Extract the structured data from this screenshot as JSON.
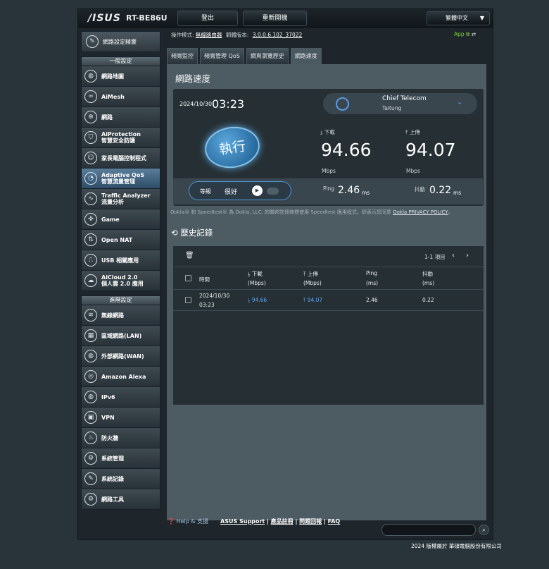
{
  "header": {
    "brand": "/ISUS",
    "model": "RT-BE86U",
    "logout": "登出",
    "reboot": "重新開機",
    "language": "繁體中文"
  },
  "status": {
    "opmode_label": "操作模式:",
    "opmode_value": "無線路由器",
    "fw_label": "韌體版本:",
    "fw_value": "3.0.0.6.102_37022",
    "app_label": "App"
  },
  "sidebar": {
    "setup_wizard": "網路設定精靈",
    "general_title": "一般設定",
    "general": [
      {
        "label": "網路地圖",
        "icon": "globe-icon"
      },
      {
        "label": "AiMesh",
        "icon": "aimesh-icon"
      },
      {
        "label": "網路",
        "icon": "network-icon"
      },
      {
        "label": "AiProtection",
        "label2": "智慧安全防護",
        "icon": "shield-icon"
      },
      {
        "label": "家長電腦控制程式",
        "icon": "family-icon"
      },
      {
        "label": "Adaptive QoS",
        "label2": "智慧流量管理",
        "icon": "speedometer-icon"
      },
      {
        "label": "Traffic Analyzer",
        "label2": "流量分析",
        "icon": "wave-icon"
      },
      {
        "label": "Game",
        "icon": "gamepad-icon"
      },
      {
        "label": "Open NAT",
        "icon": "nat-icon"
      },
      {
        "label": "USB 相關應用",
        "icon": "usb-icon"
      },
      {
        "label": "AiCloud 2.0",
        "label2": "個人雲 2.0 應用",
        "icon": "cloud-icon"
      }
    ],
    "advanced_title": "進階設定",
    "advanced": [
      {
        "label": "無線網路",
        "icon": "wifi-icon"
      },
      {
        "label": "區域網路(LAN)",
        "icon": "lan-icon"
      },
      {
        "label": "外部網路(WAN)",
        "icon": "wan-icon"
      },
      {
        "label": "Amazon Alexa",
        "icon": "alexa-icon"
      },
      {
        "label": "IPv6",
        "icon": "ipv6-icon"
      },
      {
        "label": "VPN",
        "icon": "vpn-icon"
      },
      {
        "label": "防火牆",
        "icon": "firewall-icon"
      },
      {
        "label": "系統管理",
        "icon": "admin-icon"
      },
      {
        "label": "系統記錄",
        "icon": "log-icon"
      },
      {
        "label": "網路工具",
        "icon": "tools-icon"
      }
    ]
  },
  "tabs": [
    "頻寬監控",
    "頻寬管理 QoS",
    "網頁瀏覽歷史",
    "網路速度"
  ],
  "page_title": "網路速度",
  "speedtest": {
    "date": "2024/10/30",
    "time": "03:23",
    "server_name": "Chief Telecom",
    "server_city": "Taitung",
    "go_label": "執行",
    "download_label": "下載",
    "download_value": "94.66",
    "download_unit": "Mbps",
    "upload_label": "上傳",
    "upload_value": "94.07",
    "upload_unit": "Mbps",
    "grade_label": "等級",
    "grade_value": "很好",
    "ping_label": "Ping",
    "ping_value": "2.46",
    "ping_unit": "ms",
    "jitter_label": "抖動",
    "jitter_value": "0.22",
    "jitter_unit": "ms"
  },
  "notice": {
    "text": "Ookla® 和 Speedtest® 為 Ookla, LLC. 的聯邦註冊商標使用 Speedtest 應用程式，即表示您同意",
    "link": "Ookla PRIVACY POLICY",
    "end": "。"
  },
  "history": {
    "title": "歷史記錄",
    "pagination": "1-1 項目",
    "columns": {
      "time": "時間",
      "download": "下載",
      "download_unit": "(Mbps)",
      "upload": "上傳",
      "upload_unit": "(Mbps)",
      "ping": "Ping",
      "ping_unit": "(ms)",
      "jitter": "抖動",
      "jitter_unit": "(ms)"
    },
    "rows": [
      {
        "date": "2024/10/30",
        "time": "03:23",
        "download": "94.66",
        "upload": "94.07",
        "ping": "2.46",
        "jitter": "0.22"
      }
    ]
  },
  "footer": {
    "help": "Help & 支援",
    "support": "ASUS Support",
    "sep1": " | ",
    "product_reg": "產品註冊",
    "sep2": " | ",
    "feedback": "問題回報",
    "sep3": " | ",
    "faq": "FAQ",
    "copyright": "2024 版權屬於 華碩電腦股份有限公司"
  }
}
